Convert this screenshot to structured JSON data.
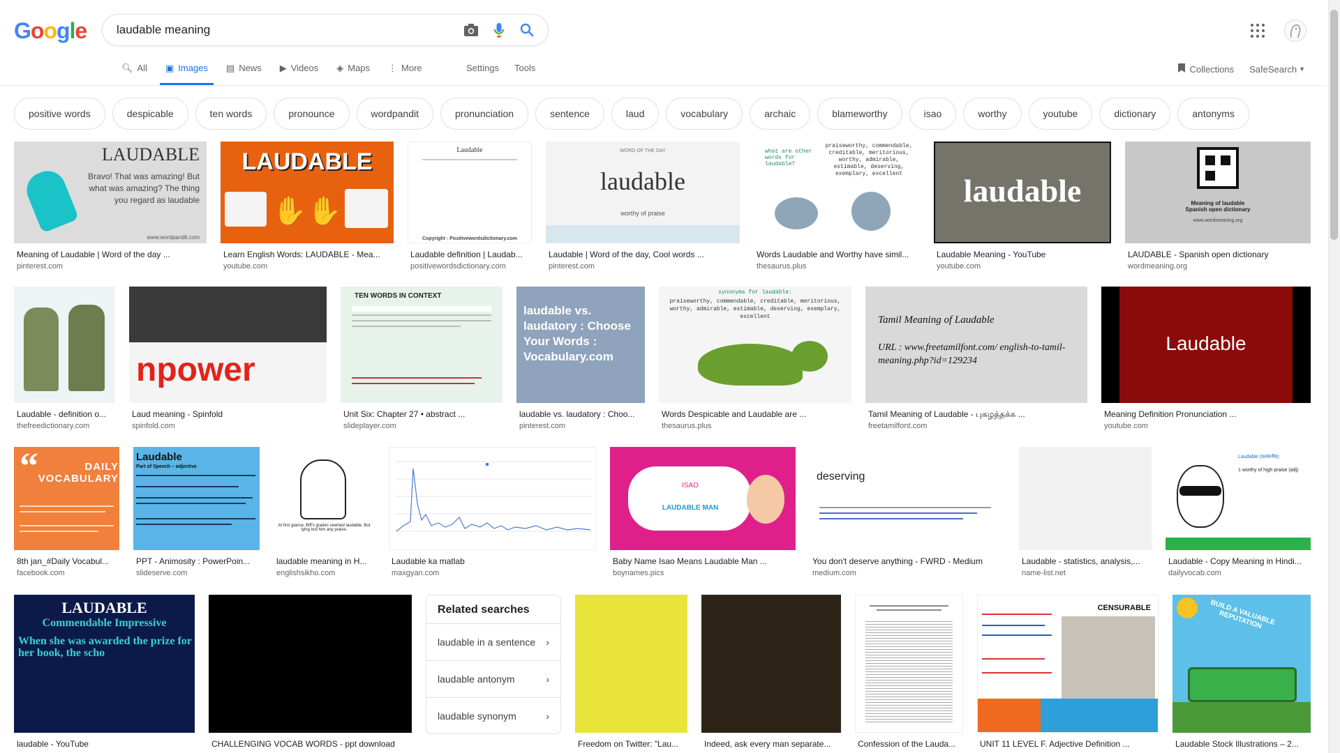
{
  "logo": {
    "letters": [
      "G",
      "o",
      "o",
      "g",
      "l",
      "e"
    ],
    "colors": [
      "#4285F4",
      "#EA4335",
      "#FBBC05",
      "#4285F4",
      "#34A853",
      "#EA4335"
    ]
  },
  "search": {
    "query": "laudable meaning"
  },
  "tabs": [
    {
      "label": "All",
      "icon": "search-icon",
      "active": false
    },
    {
      "label": "Images",
      "icon": "image-icon",
      "active": true
    },
    {
      "label": "News",
      "icon": "news-icon",
      "active": false
    },
    {
      "label": "Videos",
      "icon": "video-icon",
      "active": false
    },
    {
      "label": "Maps",
      "icon": "map-icon",
      "active": false
    },
    {
      "label": "More",
      "icon": "more-dots-icon",
      "active": false
    }
  ],
  "tools": {
    "settings": "Settings",
    "tools": "Tools"
  },
  "right_links": {
    "collections": "Collections",
    "safesearch": "SafeSearch"
  },
  "chips": [
    "positive words",
    "despicable",
    "ten words",
    "pronounce",
    "wordpandit",
    "pronunciation",
    "sentence",
    "laud",
    "vocabulary",
    "archaic",
    "blameworthy",
    "isao",
    "worthy",
    "youtube",
    "dictionary",
    "antonyms"
  ],
  "images": [
    {
      "caption": "Meaning of Laudable | Word of the day ...",
      "source": "pinterest.com",
      "art_title": "LAUDABLE",
      "art_text": "Bravo! That was amazing! But what was amazing? The thing you regard as laudable",
      "art_foot": "www.wordpandit.com",
      "bg": "#dcdcdc"
    },
    {
      "caption": "Learn English Words: LAUDABLE - Mea...",
      "source": "youtube.com",
      "art_title": "LAUDABLE",
      "bg": "#e8610f"
    },
    {
      "caption": "Laudable definition | Laudab...",
      "source": "positivewordsdictionary.com",
      "art_title": "Laudable",
      "art_foot": "Copyright - Positivewordsdictionary.com",
      "bg": "#ffffff"
    },
    {
      "caption": "Laudable | Word of the day, Cool words ...",
      "source": "pinterest.com",
      "art_top": "WORD OF THE DAY",
      "art_title": "laudable",
      "art_text": "worthy of praise",
      "bg": "#f3f3f3"
    },
    {
      "caption": "Words Laudable and Worthy have simil...",
      "source": "thesaurus.plus",
      "art_title": "what are other words for laudable?",
      "art_text": "praiseworthy, commendable, creditable, meritorious, worthy, admirable, estimable, deserving, exemplary, excellent",
      "bg": "#ffffff"
    },
    {
      "caption": "Laudable Meaning - YouTube",
      "source": "youtube.com",
      "art_title": "laudable",
      "bg": "#75746a"
    },
    {
      "caption": "LAUDABLE - Spanish open dictionary",
      "source": "wordmeaning.org",
      "art_title": "Meaning of laudable Spanish open dictionary",
      "art_foot": "www.wordmeaning.org",
      "bg": "#c8c8c8"
    },
    {
      "caption": "Laudable - definition o...",
      "source": "thefreedictionary.com",
      "bg": "#eef3f6"
    },
    {
      "caption": "Laud meaning - Spinfold",
      "source": "spinfold.com",
      "art_title": "npower",
      "bg": "#5a5a5a"
    },
    {
      "caption": "Unit Six: Chapter 27 • abstract ...",
      "source": "slideplayer.com",
      "art_title": "TEN WORDS IN CONTEXT",
      "bg": "#e7f3ea"
    },
    {
      "caption": "laudable vs. laudatory : Choo...",
      "source": "pinterest.com",
      "art_title": "laudable vs. laudatory : Choose Your Words : Vocabulary.com",
      "bg": "#8fa3bd"
    },
    {
      "caption": "Words Despicable and Laudable are ...",
      "source": "thesaurus.plus",
      "art_title": "synonyms for laudable:",
      "art_text": "praiseworthy, commendable, creditable, meritorious, worthy, admirable, estimable, deserving, exemplary, excellent",
      "bg": "#f5f5f5"
    },
    {
      "caption": "Tamil Meaning of Laudable - புகழத்தக்க ...",
      "source": "freetamilfont.com",
      "art_title": "Tamil Meaning of Laudable",
      "art_text": "URL : www.freetamilfont.com/ english-to-tamil-meaning.php?id=129234",
      "bg": "#d9d9d9"
    },
    {
      "caption": "Meaning Definition Pronunciation ...",
      "source": "youtube.com",
      "art_title": "Laudable",
      "bg": "#8b0a0a"
    },
    {
      "caption": "8th jan_#Daily Vocabul...",
      "source": "facebook.com",
      "art_title": "DAILY VOCABULARY",
      "bg": "#f0803c"
    },
    {
      "caption": "PPT - Animosity : PowerPoin...",
      "source": "slideserve.com",
      "art_title": "Laudable",
      "art_text": "Part of Speech – adjective",
      "bg": "#5ab4e8"
    },
    {
      "caption": "laudable meaning in H...",
      "source": "englishsikho.com",
      "art_text": "At first glance, Biff's grades seemed laudable. But lying lost him any praise.",
      "bg": "#ffffff"
    },
    {
      "caption": "Laudable ka matlab",
      "source": "maxgyan.com",
      "bg": "#ffffff"
    },
    {
      "caption": "Baby Name Isao Means Laudable Man ...",
      "source": "boynames.pics",
      "art_title": "ISAO",
      "art_text": "LAUDABLE MAN",
      "bg": "#e0208a"
    },
    {
      "caption": "You don't deserve anything - FWRD - Medium",
      "source": "medium.com",
      "art_title": "deserving",
      "bg": "#ffffff"
    },
    {
      "caption": "Laudable - statistics, analysis,...",
      "source": "name-list.net",
      "bg": "#f1f1f1"
    },
    {
      "caption": "Laudable - Copy Meaning in Hindi...",
      "source": "dailyvocab.com",
      "art_title": "Laudable (प्रशंसनीय)",
      "art_text": "1 worthy of high praise (adj)",
      "bg": "#ffffff"
    },
    {
      "caption": "laudable - YouTube",
      "source": "",
      "art_title": "LAUDABLE",
      "art_text": "Commendable Impressive",
      "art_foot": "When she was awarded the prize for her book, the scho",
      "bg": "#0c1a4a"
    },
    {
      "caption": "CHALLENGING VOCAB WORDS - ppt download",
      "source": "",
      "bg": "#000000"
    },
    {
      "caption": "Freedom on Twitter: \"Lau...",
      "source": "",
      "bg": "#e8e43a"
    },
    {
      "caption": "Indeed, ask every man separate...",
      "source": "",
      "bg": "#2d2417"
    },
    {
      "caption": "Confession of the Lauda...",
      "source": "",
      "bg": "#ffffff"
    },
    {
      "caption": "UNIT 11 LEVEL F. Adjective Definition ...",
      "source": "",
      "art_title": "CENSURABLE",
      "bg": "#ffffff"
    },
    {
      "caption": "Laudable Stock Illustrations – 2...",
      "source": "",
      "art_title": "BUILD A VALUABLE REPUTATION",
      "bg": "#5cc0e8"
    }
  ],
  "related": {
    "title": "Related searches",
    "items": [
      "laudable in a sentence",
      "laudable antonym",
      "laudable synonym"
    ]
  }
}
